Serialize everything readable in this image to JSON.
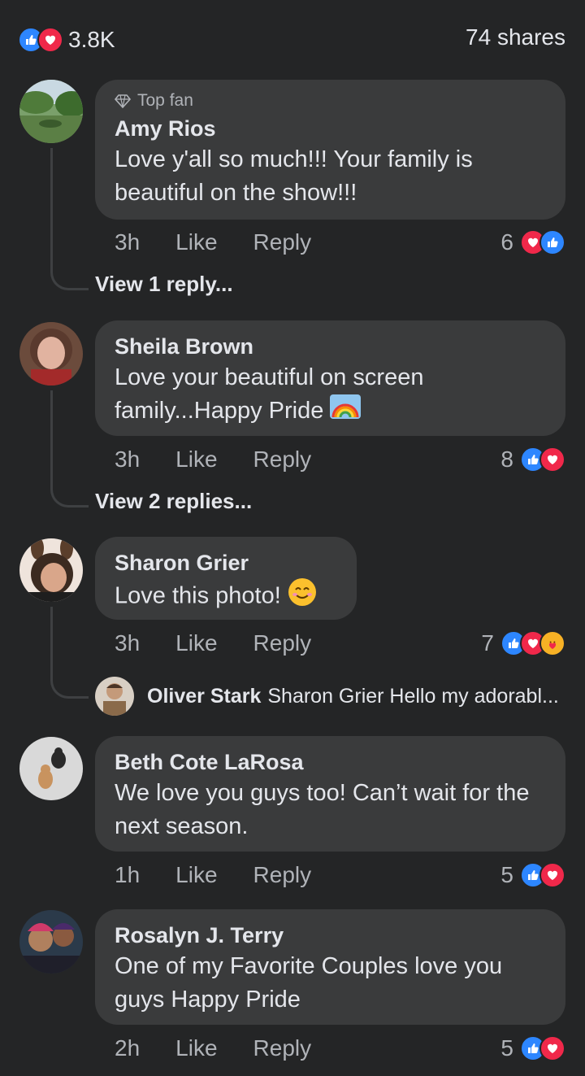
{
  "summary": {
    "reactions_count": "3.8K",
    "shares": "74 shares"
  },
  "colors": {
    "like": "#2d86ff",
    "love": "#f0284a",
    "care": "#f7b125",
    "bubble": "#3a3b3c",
    "bg": "#242526"
  },
  "comments": [
    {
      "badge": "Top fan",
      "name": "Amy Rios",
      "text": "Love y'all so much!!! Your family is beautiful on the show!!!",
      "time": "3h",
      "like": "Like",
      "reply": "Reply",
      "reactions_count": "6",
      "replies_link": "View 1 reply..."
    },
    {
      "name": "Sheila Brown",
      "text": "Love your beautiful on screen family...Happy Pride",
      "time": "3h",
      "like": "Like",
      "reply": "Reply",
      "reactions_count": "8",
      "replies_link": "View 2 replies..."
    },
    {
      "name": "Sharon Grier",
      "text": "Love this photo!",
      "time": "3h",
      "like": "Like",
      "reply": "Reply",
      "reactions_count": "7",
      "reply_preview": {
        "name": "Oliver Stark",
        "text": "Sharon Grier Hello my adorabl..."
      }
    },
    {
      "name": "Beth Cote LaRosa",
      "text": "We love you guys too! Can’t wait for the next season.",
      "time": "1h",
      "like": "Like",
      "reply": "Reply",
      "reactions_count": "5"
    },
    {
      "name": "Rosalyn J. Terry",
      "text": "One of my Favorite Couples love you guys Happy Pride",
      "time": "2h",
      "like": "Like",
      "reply": "Reply",
      "reactions_count": "5"
    }
  ]
}
